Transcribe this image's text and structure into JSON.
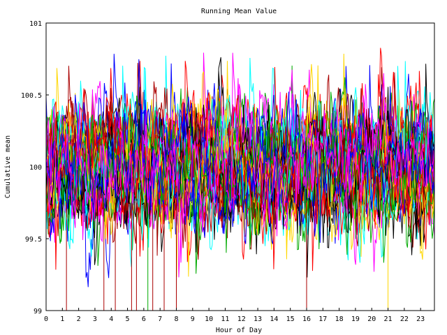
{
  "chart_data": {
    "type": "line",
    "title": "Running Mean Value",
    "xlabel": "Hour of Day",
    "ylabel": "Cumulative mean",
    "xlim": [
      0,
      23.85
    ],
    "ylim": [
      99,
      101
    ],
    "x_ticks": [
      0,
      1,
      2,
      3,
      4,
      5,
      6,
      7,
      8,
      9,
      10,
      11,
      12,
      13,
      14,
      15,
      16,
      17,
      18,
      19,
      20,
      21,
      22,
      23
    ],
    "x_tick_labels": [
      "0",
      "1",
      "2",
      "3",
      "4",
      "5",
      "6",
      "7",
      "8",
      "9",
      "10",
      "11",
      "12",
      "13",
      "14",
      "15",
      "16",
      "17",
      "18",
      "19",
      "20",
      "21",
      "22",
      "23"
    ],
    "y_ticks": [
      99,
      99.5,
      100,
      100.5,
      101
    ],
    "y_tick_labels": [
      "99",
      "99.5",
      "100",
      "100.5",
      "101"
    ],
    "grid": false,
    "legend": "none",
    "series_count": 60,
    "series_pattern": "noisy fluctuation around 100, mostly within 99.5 to 100.5, occasional excursions to 100.85 and drops to 99",
    "series_colors": [
      "#ff0000",
      "#00aa00",
      "#0000ff",
      "#ff00ff",
      "#00ffff",
      "#aa0000",
      "#ffd700",
      "#000000"
    ],
    "drop_events": [
      {
        "x": 1.25,
        "y": 99,
        "color": "#aa0000"
      },
      {
        "x": 3.55,
        "y": 99,
        "color": "#aa0000"
      },
      {
        "x": 4.25,
        "y": 99,
        "color": "#aa0000"
      },
      {
        "x": 5.25,
        "y": 99,
        "color": "#aa0000"
      },
      {
        "x": 5.55,
        "y": 99,
        "color": "#aa0000"
      },
      {
        "x": 6.25,
        "y": 99,
        "color": "#00aa00"
      },
      {
        "x": 6.55,
        "y": 99,
        "color": "#aa0000"
      },
      {
        "x": 7.25,
        "y": 99,
        "color": "#aa0000"
      },
      {
        "x": 8.0,
        "y": 99,
        "color": "#aa0000"
      },
      {
        "x": 16.0,
        "y": 99,
        "color": "#aa0000"
      },
      {
        "x": 21.0,
        "y": 99,
        "color": "#ffd700"
      }
    ]
  }
}
